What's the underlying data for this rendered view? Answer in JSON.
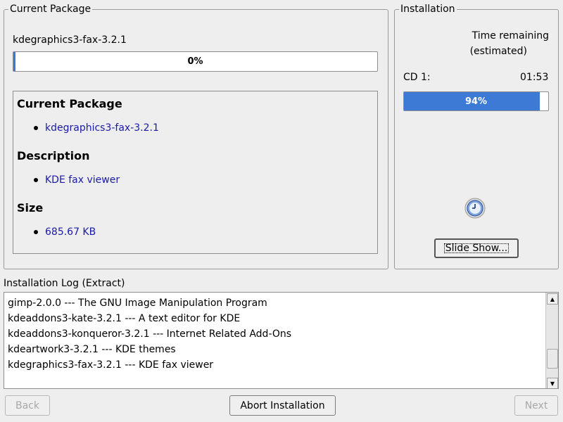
{
  "current_package": {
    "group_title": "Current Package",
    "package_name": "kdegraphics3-fax-3.2.1",
    "progress_text": "0%",
    "progress_value": 0,
    "details": {
      "package_heading": "Current Package",
      "package_value": "kdegraphics3-fax-3.2.1",
      "description_heading": "Description",
      "description_value": "KDE fax viewer",
      "size_heading": "Size",
      "size_value": "685.67 KB"
    }
  },
  "installation": {
    "group_title": "Installation",
    "time_remaining_line1": "Time remaining",
    "time_remaining_line2": "(estimated)",
    "cd_label": "CD 1:",
    "cd_time": "01:53",
    "progress_text": "94%",
    "progress_value": 94,
    "slide_show_label": "Slide Show...",
    "clock_icon": "clock-icon"
  },
  "log": {
    "title": "Installation Log (Extract)",
    "lines": [
      "gimp-2.0.0 --- The GNU Image Manipulation Program",
      "kdeaddons3-kate-3.2.1 --- A text editor for KDE",
      "kdeaddons3-konqueror-3.2.1 --- Internet Related Add-Ons",
      "kdeartwork3-3.2.1 --- KDE themes",
      "kdegraphics3-fax-3.2.1 --- KDE fax viewer"
    ]
  },
  "footer": {
    "back_label": "Back",
    "abort_label": "Abort Installation",
    "next_label": "Next"
  },
  "colors": {
    "progress_blue": "#3d7ad6",
    "link_blue": "#1a1aa6"
  }
}
